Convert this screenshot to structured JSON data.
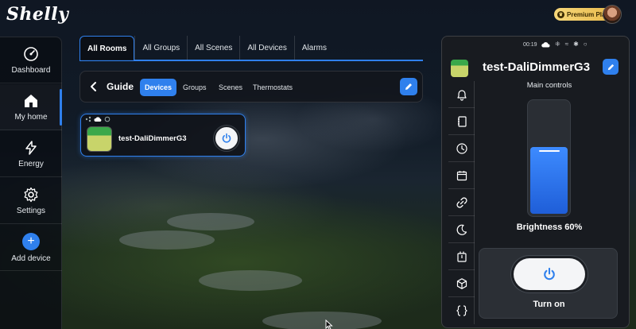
{
  "app": {
    "logo": "Shelly",
    "premium_badge": "Premium Plan"
  },
  "colors": {
    "accent": "#2f80ed",
    "premium": "#f6d77a"
  },
  "sidebar": {
    "items": [
      {
        "label": "Dashboard",
        "icon": "gauge-icon",
        "active": false
      },
      {
        "label": "My home",
        "icon": "home-icon",
        "active": true
      },
      {
        "label": "Energy",
        "icon": "bolt-icon",
        "active": false
      },
      {
        "label": "Settings",
        "icon": "gear-icon",
        "active": false
      },
      {
        "label": "Add device",
        "icon": "plus-icon",
        "active": false
      }
    ]
  },
  "room_tabs": [
    "All Rooms",
    "All Groups",
    "All Scenes",
    "All Devices",
    "Alarms"
  ],
  "guide_bar": {
    "title": "Guide",
    "filters": [
      "Devices",
      "Groups",
      "Scenes",
      "Thermostats"
    ],
    "active_filter": "Devices"
  },
  "device_card": {
    "name": "test-DaliDimmerG3"
  },
  "panel": {
    "status_bar": {
      "time": "00:19"
    },
    "device_name": "test-DaliDimmerG3",
    "section_label": "Main controls",
    "brightness_level": 0.6,
    "brightness_label": "Brightness 60%",
    "power_label": "Turn on",
    "side_icons": [
      "bell-icon",
      "notebook-icon",
      "clock-icon",
      "calendar-icon",
      "link-icon",
      "moon-icon",
      "timer-device-icon",
      "cube-icon",
      "braces-icon"
    ]
  }
}
